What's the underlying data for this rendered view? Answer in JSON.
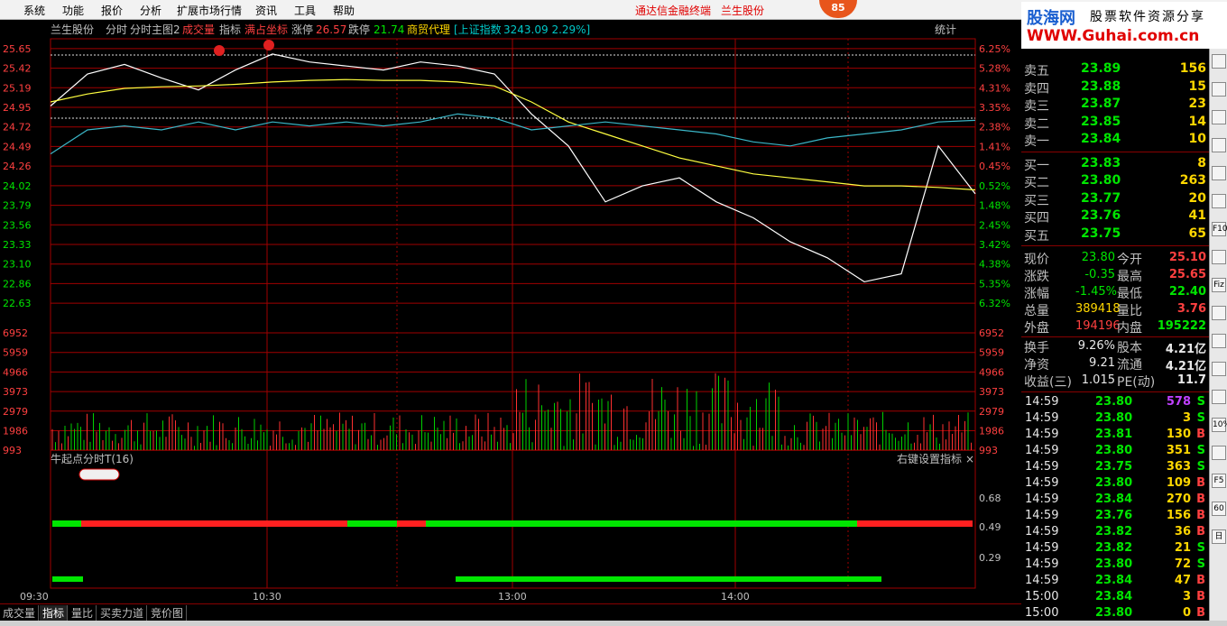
{
  "menubar": {
    "items": [
      "系统",
      "功能",
      "报价",
      "分析",
      "扩展市场行情",
      "资讯",
      "工具",
      "帮助"
    ],
    "title_left": "通达信金融终端",
    "title_right": "兰生股份",
    "badge": "85"
  },
  "watermark": {
    "brand": "股海网",
    "slogan": "股票软件资源分享",
    "url": "WWW.Guhai.com.cn"
  },
  "chart_header": {
    "stock": "兰生股份",
    "items": [
      "分时",
      "分时主图2",
      "成交量",
      "指标"
    ],
    "full_coord": "满占坐标",
    "limit_up_label": "涨停",
    "limit_up": "26.57",
    "limit_down_label": "跌停",
    "limit_down": "21.74",
    "sector": "商贸代理",
    "index_label": "[上证指数",
    "index_value": "3243.09 2.29%]",
    "stats": "统计"
  },
  "price_axis": {
    "left": [
      "25.65",
      "25.42",
      "25.19",
      "24.95",
      "24.72",
      "24.49",
      "24.26",
      "24.02",
      "23.79",
      "23.56",
      "23.33",
      "23.10",
      "22.86",
      "22.63"
    ],
    "right": [
      "6.25%",
      "5.28%",
      "4.31%",
      "3.35%",
      "2.38%",
      "1.41%",
      "0.45%",
      "0.52%",
      "1.48%",
      "2.45%",
      "3.42%",
      "4.38%",
      "5.35%",
      "6.32%"
    ]
  },
  "volume_axis": [
    "6952",
    "5959",
    "4966",
    "3973",
    "2979",
    "1986",
    "993"
  ],
  "indicator": {
    "name": "牛起点分时T(16)",
    "hint": "右键设置指标",
    "close": "×",
    "axis": [
      "0.68",
      "0.49",
      "0.29"
    ]
  },
  "time_axis": [
    "09:30",
    "10:30",
    "13:00",
    "14:00"
  ],
  "bottom_tabs": [
    "成交量",
    "指标",
    "量比",
    "买卖力道",
    "竞价图"
  ],
  "order_book": {
    "sell": [
      {
        "label": "卖五",
        "price": "23.89",
        "vol": "156"
      },
      {
        "label": "卖四",
        "price": "23.88",
        "vol": "15"
      },
      {
        "label": "卖三",
        "price": "23.87",
        "vol": "23"
      },
      {
        "label": "卖二",
        "price": "23.85",
        "vol": "14"
      },
      {
        "label": "卖一",
        "price": "23.84",
        "vol": "10"
      }
    ],
    "buy": [
      {
        "label": "买一",
        "price": "23.83",
        "vol": "8"
      },
      {
        "label": "买二",
        "price": "23.80",
        "vol": "263"
      },
      {
        "label": "买三",
        "price": "23.77",
        "vol": "20"
      },
      {
        "label": "买四",
        "price": "23.76",
        "vol": "41"
      },
      {
        "label": "买五",
        "price": "23.75",
        "vol": "65"
      }
    ]
  },
  "quote": [
    {
      "l1": "现价",
      "v1": "23.80",
      "c1": "green",
      "l2": "今开",
      "v2": "25.10",
      "c2": "red"
    },
    {
      "l1": "涨跌",
      "v1": "-0.35",
      "c1": "green",
      "l2": "最高",
      "v2": "25.65",
      "c2": "red"
    },
    {
      "l1": "涨幅",
      "v1": "-1.45%",
      "c1": "green",
      "l2": "最低",
      "v2": "22.40",
      "c2": "green"
    },
    {
      "l1": "总量",
      "v1": "389418",
      "c1": "yellow",
      "l2": "量比",
      "v2": "3.76",
      "c2": "red"
    },
    {
      "l1": "外盘",
      "v1": "194196",
      "c1": "red",
      "l2": "内盘",
      "v2": "195222",
      "c2": "green"
    },
    {
      "l1": "换手",
      "v1": "9.26%",
      "c1": "white",
      "l2": "股本",
      "v2": "4.21亿",
      "c2": "white"
    },
    {
      "l1": "净资",
      "v1": "9.21",
      "c1": "white",
      "l2": "流通",
      "v2": "4.21亿",
      "c2": "white"
    },
    {
      "l1": "收益(三)",
      "v1": "1.015",
      "c1": "white",
      "l2": "PE(动)",
      "v2": "11.7",
      "c2": "white"
    }
  ],
  "ticks": [
    {
      "t": "14:59",
      "p": "23.80",
      "v": "578",
      "s": "S"
    },
    {
      "t": "14:59",
      "p": "23.80",
      "v": "3",
      "s": "S"
    },
    {
      "t": "14:59",
      "p": "23.81",
      "v": "130",
      "s": "B"
    },
    {
      "t": "14:59",
      "p": "23.80",
      "v": "351",
      "s": "S"
    },
    {
      "t": "14:59",
      "p": "23.75",
      "v": "363",
      "s": "S"
    },
    {
      "t": "14:59",
      "p": "23.80",
      "v": "109",
      "s": "B"
    },
    {
      "t": "14:59",
      "p": "23.84",
      "v": "270",
      "s": "B"
    },
    {
      "t": "14:59",
      "p": "23.76",
      "v": "156",
      "s": "B"
    },
    {
      "t": "14:59",
      "p": "23.82",
      "v": "36",
      "s": "B"
    },
    {
      "t": "14:59",
      "p": "23.82",
      "v": "21",
      "s": "S"
    },
    {
      "t": "14:59",
      "p": "23.80",
      "v": "72",
      "s": "S"
    },
    {
      "t": "14:59",
      "p": "23.84",
      "v": "47",
      "s": "B"
    },
    {
      "t": "15:00",
      "p": "23.84",
      "v": "3",
      "s": "B"
    },
    {
      "t": "15:00",
      "p": "23.80",
      "v": "0",
      "s": "B"
    }
  ],
  "toolbar_icons": [
    "arrow-up-icon",
    "arrow-down-icon",
    "chart-icon",
    "candle-icon",
    "fund-icon",
    "grid-icon",
    "f10-icon",
    "info-icon",
    "fiz-icon",
    "pie-icon",
    "refresh-icon",
    "trend-icon",
    "bar-icon",
    "percent-icon",
    "pen-icon",
    "f5-icon",
    "f6-icon",
    "calendar-icon"
  ],
  "toolbar_labels": [
    "",
    "",
    "",
    "",
    "",
    "",
    "F10",
    "",
    "Fiz",
    "",
    "",
    "",
    "",
    "10%",
    "",
    "F5",
    "60",
    "日"
  ],
  "chart_data": {
    "type": "line",
    "prev_close": 24.15,
    "price_range": [
      22.4,
      25.65
    ],
    "volume_max": 6952,
    "series": [
      {
        "name": "price",
        "x": [
          "09:30",
          "09:40",
          "09:50",
          "10:00",
          "10:10",
          "10:20",
          "10:30",
          "10:40",
          "10:50",
          "11:00",
          "11:10",
          "11:20",
          "11:30",
          "13:00",
          "13:10",
          "13:20",
          "13:30",
          "13:40",
          "13:50",
          "14:00",
          "14:10",
          "14:20",
          "14:30",
          "14:40",
          "14:50",
          "15:00"
        ],
        "values": [
          24.9,
          25.3,
          25.42,
          25.25,
          25.1,
          25.35,
          25.55,
          25.45,
          25.4,
          25.35,
          25.45,
          25.4,
          25.3,
          24.8,
          24.4,
          23.7,
          23.9,
          24.0,
          23.7,
          23.5,
          23.2,
          23.0,
          22.7,
          22.8,
          24.4,
          23.8
        ]
      },
      {
        "name": "avg",
        "values": [
          24.95,
          25.05,
          25.12,
          25.14,
          25.15,
          25.17,
          25.2,
          25.22,
          25.23,
          25.22,
          25.22,
          25.2,
          25.15,
          24.95,
          24.7,
          24.55,
          24.4,
          24.25,
          24.15,
          24.05,
          24.0,
          23.95,
          23.9,
          23.9,
          23.88,
          23.85
        ]
      },
      {
        "name": "index",
        "values": [
          24.3,
          24.6,
          24.65,
          24.6,
          24.7,
          24.6,
          24.7,
          24.65,
          24.7,
          24.65,
          24.7,
          24.8,
          24.75,
          24.6,
          24.65,
          24.7,
          24.65,
          24.6,
          24.55,
          24.45,
          24.4,
          24.5,
          24.55,
          24.6,
          24.7,
          24.72
        ]
      }
    ]
  }
}
